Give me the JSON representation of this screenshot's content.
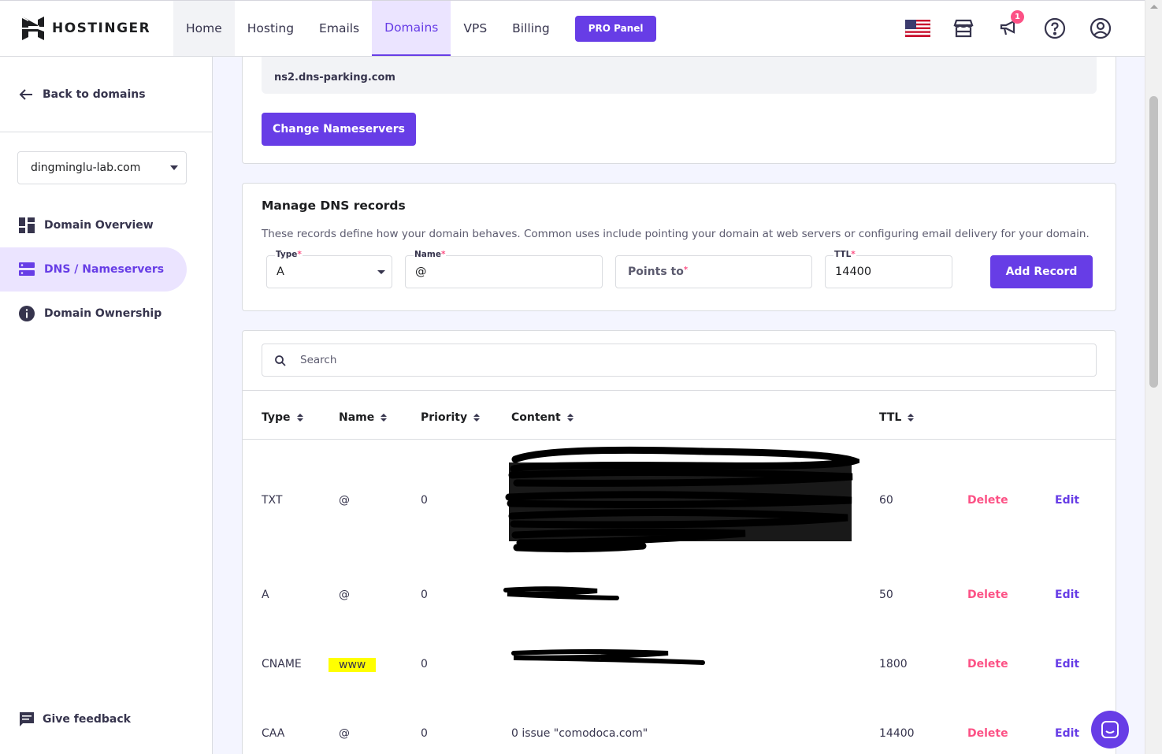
{
  "brand": {
    "name": "HOSTINGER"
  },
  "nav": {
    "items": [
      {
        "label": "Home"
      },
      {
        "label": "Hosting"
      },
      {
        "label": "Emails"
      },
      {
        "label": "Domains"
      },
      {
        "label": "VPS"
      },
      {
        "label": "Billing"
      }
    ],
    "active": "Domains",
    "pro_button": "PRO Panel"
  },
  "top_icons": {
    "flag": "us-flag-icon",
    "store": "store-icon",
    "announcements": "megaphone-icon",
    "announcements_badge": "1",
    "help": "help-icon",
    "account": "account-icon"
  },
  "sidebar": {
    "back_label": "Back to domains",
    "domain_select_value": "dingminglu-lab.com",
    "items": [
      {
        "label": "Domain Overview",
        "icon": "dashboard-icon"
      },
      {
        "label": "DNS / Nameservers",
        "icon": "server-icon",
        "active": true
      },
      {
        "label": "Domain Ownership",
        "icon": "info-icon"
      }
    ],
    "feedback_label": "Give feedback"
  },
  "nameservers": {
    "ns2": "ns2.dns-parking.com",
    "change_button": "Change Nameservers"
  },
  "dns_form": {
    "title": "Manage DNS records",
    "description": "These records define how your domain behaves. Common uses include pointing your domain at web servers or configuring email delivery for your domain.",
    "type_label": "Type",
    "type_value": "A",
    "name_label": "Name",
    "name_value": "@",
    "points_to_placeholder": "Points to",
    "ttl_label": "TTL",
    "ttl_value": "14400",
    "add_button": "Add Record"
  },
  "records": {
    "search_placeholder": "Search",
    "columns": [
      "Type",
      "Name",
      "Priority",
      "Content",
      "TTL"
    ],
    "delete_label": "Delete",
    "edit_label": "Edit",
    "rows": [
      {
        "type": "TXT",
        "name": "@",
        "priority": "0",
        "content": "",
        "ttl": "60"
      },
      {
        "type": "A",
        "name": "@",
        "priority": "0",
        "content": "",
        "ttl": "50"
      },
      {
        "type": "CNAME",
        "name": "www",
        "priority": "0",
        "content": "",
        "ttl": "1800"
      },
      {
        "type": "CAA",
        "name": "@",
        "priority": "0",
        "content": "0 issue \"comodoca.com\"",
        "ttl": "14400"
      }
    ]
  },
  "colors": {
    "accent": "#673de6",
    "danger": "#fc5185",
    "highlight": "#ffff00"
  }
}
